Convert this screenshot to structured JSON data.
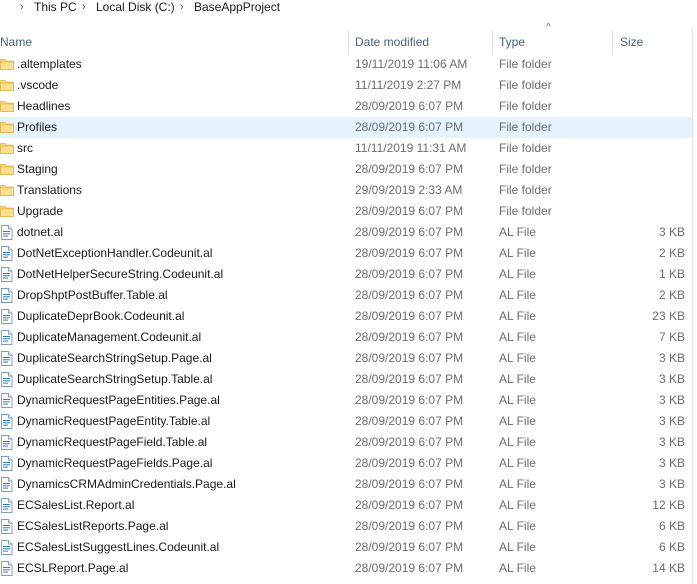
{
  "breadcrumb": [
    "This PC",
    "Local Disk (C:)",
    "BaseAppProject"
  ],
  "columns": {
    "name": "Name",
    "date": "Date modified",
    "type": "Type",
    "size": "Size"
  },
  "colors": {
    "folder": "#f8d775",
    "selection": "#e5f3ff",
    "header_text": "#4c607a"
  },
  "rows": [
    {
      "name": ".altemplates",
      "date": "19/11/2019 11:06 AM",
      "type": "File folder",
      "size": "",
      "kind": "folder"
    },
    {
      "name": ".vscode",
      "date": "11/11/2019 2:27 PM",
      "type": "File folder",
      "size": "",
      "kind": "folder"
    },
    {
      "name": "Headlines",
      "date": "28/09/2019 6:07 PM",
      "type": "File folder",
      "size": "",
      "kind": "folder"
    },
    {
      "name": "Profiles",
      "date": "28/09/2019 6:07 PM",
      "type": "File folder",
      "size": "",
      "kind": "folder",
      "selected": true
    },
    {
      "name": "src",
      "date": "11/11/2019 11:31 AM",
      "type": "File folder",
      "size": "",
      "kind": "folder"
    },
    {
      "name": "Staging",
      "date": "28/09/2019 6:07 PM",
      "type": "File folder",
      "size": "",
      "kind": "folder"
    },
    {
      "name": "Translations",
      "date": "29/09/2019 2:33 AM",
      "type": "File folder",
      "size": "",
      "kind": "folder"
    },
    {
      "name": "Upgrade",
      "date": "28/09/2019 6:07 PM",
      "type": "File folder",
      "size": "",
      "kind": "folder"
    },
    {
      "name": "dotnet.al",
      "date": "28/09/2019 6:07 PM",
      "type": "AL File",
      "size": "3 KB",
      "kind": "file"
    },
    {
      "name": "DotNetExceptionHandler.Codeunit.al",
      "date": "28/09/2019 6:07 PM",
      "type": "AL File",
      "size": "2 KB",
      "kind": "file"
    },
    {
      "name": "DotNetHelperSecureString.Codeunit.al",
      "date": "28/09/2019 6:07 PM",
      "type": "AL File",
      "size": "1 KB",
      "kind": "file"
    },
    {
      "name": "DropShptPostBuffer.Table.al",
      "date": "28/09/2019 6:07 PM",
      "type": "AL File",
      "size": "2 KB",
      "kind": "file"
    },
    {
      "name": "DuplicateDeprBook.Codeunit.al",
      "date": "28/09/2019 6:07 PM",
      "type": "AL File",
      "size": "23 KB",
      "kind": "file"
    },
    {
      "name": "DuplicateManagement.Codeunit.al",
      "date": "28/09/2019 6:07 PM",
      "type": "AL File",
      "size": "7 KB",
      "kind": "file"
    },
    {
      "name": "DuplicateSearchStringSetup.Page.al",
      "date": "28/09/2019 6:07 PM",
      "type": "AL File",
      "size": "3 KB",
      "kind": "file"
    },
    {
      "name": "DuplicateSearchStringSetup.Table.al",
      "date": "28/09/2019 6:07 PM",
      "type": "AL File",
      "size": "3 KB",
      "kind": "file"
    },
    {
      "name": "DynamicRequestPageEntities.Page.al",
      "date": "28/09/2019 6:07 PM",
      "type": "AL File",
      "size": "3 KB",
      "kind": "file"
    },
    {
      "name": "DynamicRequestPageEntity.Table.al",
      "date": "28/09/2019 6:07 PM",
      "type": "AL File",
      "size": "3 KB",
      "kind": "file"
    },
    {
      "name": "DynamicRequestPageField.Table.al",
      "date": "28/09/2019 6:07 PM",
      "type": "AL File",
      "size": "3 KB",
      "kind": "file"
    },
    {
      "name": "DynamicRequestPageFields.Page.al",
      "date": "28/09/2019 6:07 PM",
      "type": "AL File",
      "size": "3 KB",
      "kind": "file"
    },
    {
      "name": "DynamicsCRMAdminCredentials.Page.al",
      "date": "28/09/2019 6:07 PM",
      "type": "AL File",
      "size": "3 KB",
      "kind": "file"
    },
    {
      "name": "ECSalesList.Report.al",
      "date": "28/09/2019 6:07 PM",
      "type": "AL File",
      "size": "12 KB",
      "kind": "file"
    },
    {
      "name": "ECSalesListReports.Page.al",
      "date": "28/09/2019 6:07 PM",
      "type": "AL File",
      "size": "6 KB",
      "kind": "file"
    },
    {
      "name": "ECSalesListSuggestLines.Codeunit.al",
      "date": "28/09/2019 6:07 PM",
      "type": "AL File",
      "size": "6 KB",
      "kind": "file"
    },
    {
      "name": "ECSLReport.Page.al",
      "date": "28/09/2019 6:07 PM",
      "type": "AL File",
      "size": "14 KB",
      "kind": "file"
    }
  ]
}
